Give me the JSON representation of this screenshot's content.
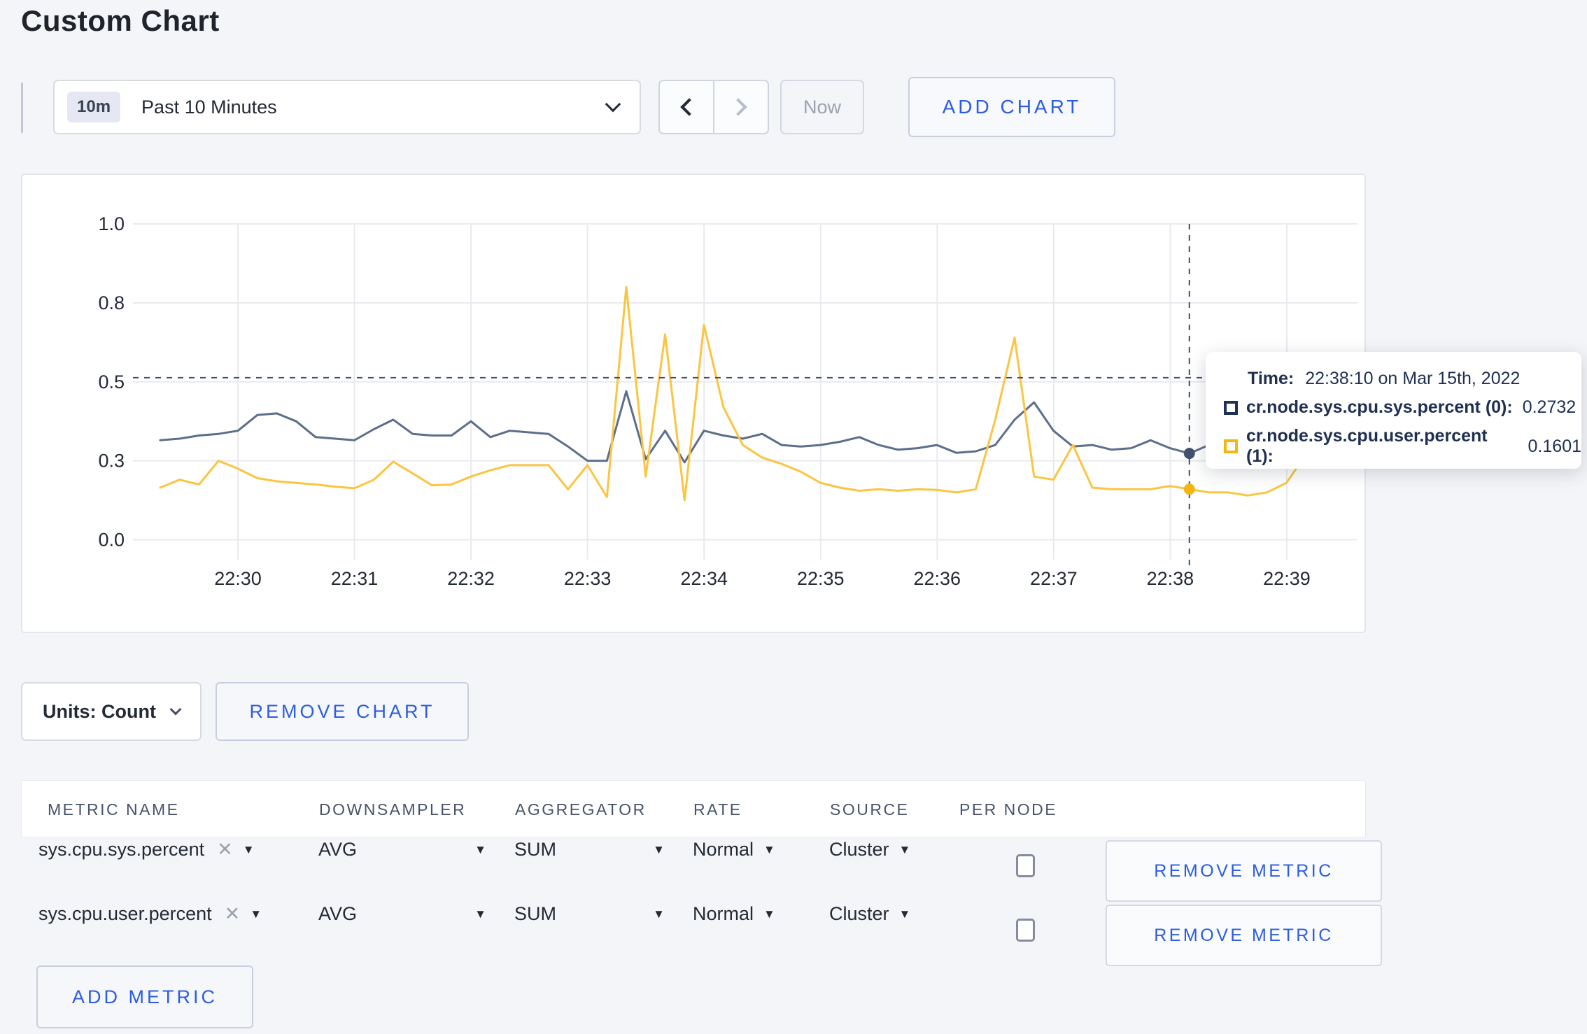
{
  "page_title": "Custom Chart",
  "toolbar": {
    "time_range_badge": "10m",
    "time_range_label": "Past 10 Minutes",
    "prev_label": "previous time window",
    "next_label": "next time window",
    "now_label": "Now",
    "add_chart_label": "ADD CHART"
  },
  "chart_data": {
    "type": "line",
    "title": "",
    "xlabel": "",
    "ylabel": "",
    "ylim": [
      0,
      1
    ],
    "grid": true,
    "x_tick_labels": [
      "22:30",
      "22:31",
      "22:32",
      "22:33",
      "22:34",
      "22:35",
      "22:36",
      "22:37",
      "22:38",
      "22:39"
    ],
    "y_ticks": [
      {
        "value": 0,
        "label": "0.0"
      },
      {
        "value": 0.25,
        "label": "0.3"
      },
      {
        "value": 0.5,
        "label": "0.5"
      },
      {
        "value": 0.75,
        "label": "0.8"
      },
      {
        "value": 1.0,
        "label": "1.0"
      }
    ],
    "x_start_time": "22:29:20",
    "x_interval_seconds": 10,
    "series": [
      {
        "name": "cr.node.sys.cpu.sys.percent",
        "color": "#5c6e8b",
        "values": [
          0.315,
          0.32,
          0.33,
          0.335,
          0.345,
          0.395,
          0.4,
          0.375,
          0.325,
          0.32,
          0.315,
          0.35,
          0.38,
          0.335,
          0.33,
          0.33,
          0.375,
          0.325,
          0.345,
          0.34,
          0.335,
          0.295,
          0.25,
          0.25,
          0.47,
          0.255,
          0.345,
          0.245,
          0.345,
          0.33,
          0.32,
          0.335,
          0.3,
          0.295,
          0.3,
          0.31,
          0.325,
          0.3,
          0.285,
          0.29,
          0.3,
          0.275,
          0.28,
          0.3,
          0.38,
          0.435,
          0.345,
          0.295,
          0.3,
          0.285,
          0.29,
          0.315,
          0.29,
          0.2732,
          0.3,
          0.31,
          0.3,
          0.29,
          0.3,
          0.31,
          0.3
        ]
      },
      {
        "name": "cr.node.sys.cpu.user.percent",
        "color": "#fbc541",
        "values": [
          0.165,
          0.19,
          0.175,
          0.25,
          0.225,
          0.195,
          0.185,
          0.18,
          0.175,
          0.168,
          0.163,
          0.19,
          0.247,
          0.21,
          0.172,
          0.175,
          0.2,
          0.22,
          0.236,
          0.236,
          0.236,
          0.16,
          0.236,
          0.135,
          0.8,
          0.2,
          0.65,
          0.125,
          0.68,
          0.42,
          0.3,
          0.26,
          0.24,
          0.215,
          0.18,
          0.165,
          0.155,
          0.16,
          0.155,
          0.16,
          0.158,
          0.15,
          0.16,
          0.38,
          0.64,
          0.2,
          0.19,
          0.3,
          0.165,
          0.16,
          0.16,
          0.16,
          0.17,
          0.1601,
          0.15,
          0.15,
          0.14,
          0.15,
          0.18,
          0.27,
          0.255
        ]
      }
    ],
    "crosshair": {
      "x_index": 53,
      "x_time": "22:38:10",
      "y_value": 0.513,
      "point_values": [
        0.2732,
        0.1601
      ]
    },
    "legend_position": "tooltip"
  },
  "tooltip": {
    "time_label": "Time:",
    "time_value": "22:38:10 on Mar 15th, 2022",
    "series": [
      {
        "name": "cr.node.sys.cpu.sys.percent (0):",
        "value": "0.2732",
        "swatch_color": "#1e3156"
      },
      {
        "name": "cr.node.sys.cpu.user.percent (1):",
        "value": "0.1601",
        "swatch_color": "#f3b713"
      }
    ]
  },
  "units": {
    "label": "Units: Count"
  },
  "remove_chart_label": "REMOVE CHART",
  "metrics_table": {
    "columns": [
      "METRIC NAME",
      "DOWNSAMPLER",
      "AGGREGATOR",
      "RATE",
      "SOURCE",
      "PER NODE"
    ],
    "rows": [
      {
        "metric": "sys.cpu.sys.percent",
        "downsampler": "AVG",
        "aggregator": "SUM",
        "rate": "Normal",
        "source": "Cluster",
        "per_node_checked": false,
        "remove_label": "REMOVE METRIC"
      },
      {
        "metric": "sys.cpu.user.percent",
        "downsampler": "AVG",
        "aggregator": "SUM",
        "rate": "Normal",
        "source": "Cluster",
        "per_node_checked": false,
        "remove_label": "REMOVE METRIC"
      }
    ],
    "add_metric_label": "ADD METRIC",
    "close_icon_glyph": "✕",
    "caret_icon_glyph": "▼"
  }
}
